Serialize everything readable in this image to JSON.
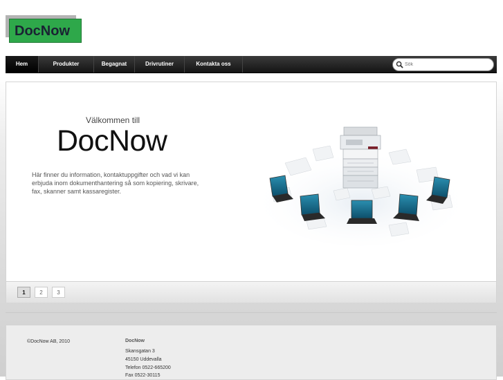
{
  "logo": {
    "text": "DocNow"
  },
  "nav": {
    "items": [
      {
        "label": "Hem"
      },
      {
        "label": "Produkter"
      },
      {
        "label": "Begagnat"
      },
      {
        "label": "Drivrutiner"
      },
      {
        "label": "Kontakta oss"
      }
    ]
  },
  "search": {
    "placeholder": "Sök",
    "icon": "search-icon"
  },
  "slide": {
    "welcome": "Välkommen till",
    "brand": "DocNow",
    "intro": "Här finner du information, kontaktuppgifter och vad vi kan erbjuda inom dokumenthantering så som kopiering, skrivare, fax, skanner samt kassaregister."
  },
  "pager": {
    "pages": [
      "1",
      "2",
      "3"
    ],
    "active": "1"
  },
  "footer": {
    "copyright": "©DocNow AB, 2010",
    "company_title": "DocNow",
    "address_line1": "Skansgatan 3",
    "address_line2": "45150 Uddevalla",
    "phone": "Telefon 0522-665200",
    "fax": "Fax 0522-30115"
  },
  "colors": {
    "logo_green": "#2ea84a",
    "nav_bg": "#1a1a1a"
  }
}
